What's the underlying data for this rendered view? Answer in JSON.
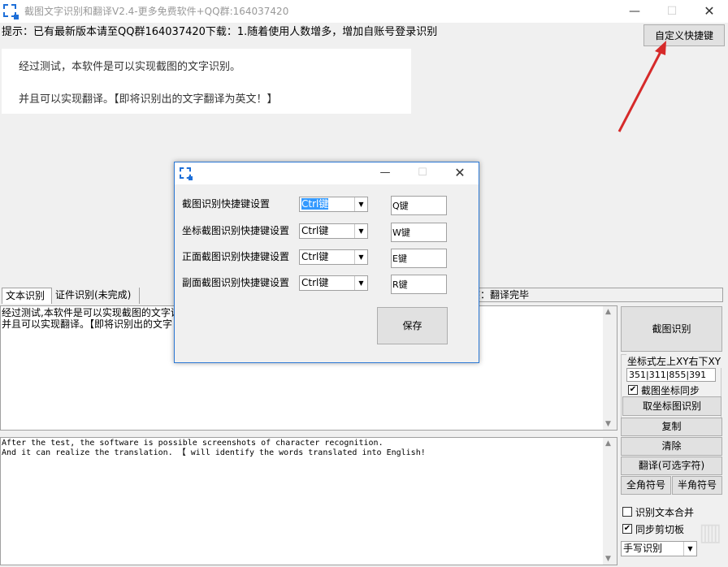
{
  "window": {
    "title": "截图文字识别和翻译V2.4-更多免费软件+QQ群:164037420",
    "min": "—",
    "max": "☐",
    "close": "✕"
  },
  "hint": "提示：已有最新版本请至QQ群164037420下载：1.随着使用人数增多，增加自账号登录识别",
  "shortcut_button": "自定义快捷键",
  "info": {
    "line1": "经过测试，本软件是可以实现截图的文字识别。",
    "line2": "并且可以实现翻译。【即将识别出的文字翻译为英文！】"
  },
  "tabs": [
    "文本识别",
    "证件识别(未完成)"
  ],
  "status": "态：翻译完毕",
  "ocr_text": "经过测试,本软件是可以实现截图的文字识\n并且可以实现翻译。【即将识别出的文字",
  "translation_text": "After the test, the software is possible screenshots of character recognition.\nAnd it can realize the translation. 【 will identify the words translated into English!",
  "sidebar": {
    "capture": "截图识别",
    "coord_legend": "坐标式左上XY右下XY",
    "coord_value": "351|311|855|391",
    "coord_sync": "截图坐标同步",
    "coord_capture": "取坐标图识别",
    "copy": "复制",
    "clear": "清除",
    "translate": "翻译(可选字符)",
    "fullwidth": "全角符号",
    "halfwidth": "半角符号",
    "merge": "识别文本合并",
    "clipboard": "同步剪切板",
    "mode": "手写识别"
  },
  "checks": {
    "coord_sync": true,
    "merge": false,
    "clipboard": true
  },
  "dialog": {
    "min": "—",
    "max": "☐",
    "close": "✕",
    "rows": [
      {
        "label": "截图识别快捷键设置",
        "modifier": "Ctrl键",
        "key": "Q键"
      },
      {
        "label": "坐标截图识别快捷键设置",
        "modifier": "Ctrl键",
        "key": "W键"
      },
      {
        "label": "正面截图识别快捷键设置",
        "modifier": "Ctrl键",
        "key": "E键"
      },
      {
        "label": "副面截图识别快捷键设置",
        "modifier": "Ctrl键",
        "key": "R键"
      }
    ],
    "save": "保存"
  },
  "colors": {
    "accent": "#1e6fd8",
    "arrow": "#d62a2a",
    "selection": "#3399ff"
  }
}
